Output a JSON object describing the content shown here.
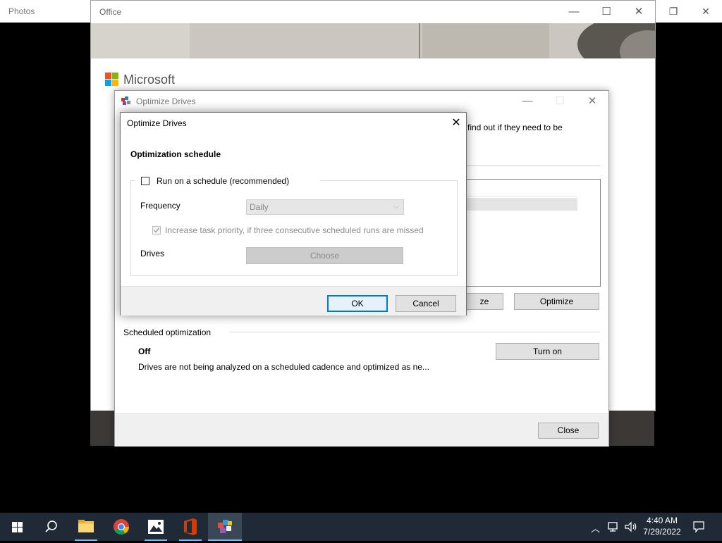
{
  "photos": {
    "title": "Photos"
  },
  "office": {
    "title": "Office",
    "brand": "Microsoft"
  },
  "optimize_drives": {
    "title": "Optimize Drives",
    "partial_text": "find out if they need to be",
    "partial_button": "ze",
    "optimize_label": "Optimize",
    "scheduled": {
      "heading": "Scheduled optimization",
      "status": "Off",
      "description": "Drives are not being analyzed on a scheduled cadence and optimized as ne...",
      "turn_on_label": "Turn on"
    },
    "close_label": "Close"
  },
  "dialog": {
    "title": "Optimize Drives",
    "section_title": "Optimization schedule",
    "run_on_schedule_label": "Run on a schedule (recommended)",
    "run_on_schedule_checked": false,
    "frequency_label": "Frequency",
    "frequency_value": "Daily",
    "increase_priority_label": "Increase task priority, if three consecutive scheduled runs are missed",
    "increase_priority_checked": true,
    "drives_label": "Drives",
    "choose_label": "Choose",
    "ok_label": "OK",
    "cancel_label": "Cancel"
  },
  "taskbar": {
    "time": "4:40 AM",
    "date": "7/29/2022",
    "apps": [
      "start-icon",
      "search-icon",
      "file-explorer-icon",
      "chrome-icon",
      "photos-icon",
      "office-icon",
      "defrag-icon"
    ]
  },
  "colors": {
    "accent": "#0078d7",
    "taskbar": "#1f2a36"
  }
}
